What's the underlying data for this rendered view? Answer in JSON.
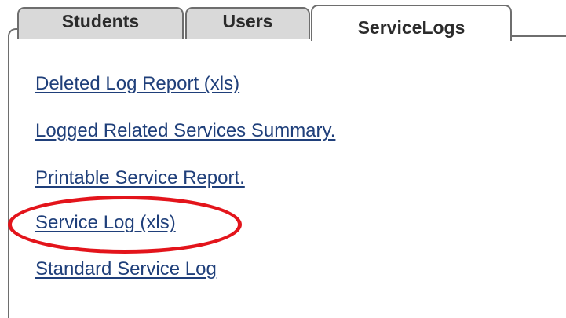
{
  "tabs": [
    {
      "label": "Students",
      "active": false
    },
    {
      "label": "Users",
      "active": false
    },
    {
      "label": "ServiceLogs",
      "active": true
    }
  ],
  "reports": [
    {
      "label": "Deleted Log Report (xls)"
    },
    {
      "label": "Logged Related Services Summary."
    },
    {
      "label": "Printable Service Report."
    },
    {
      "label": "Service Log (xls)",
      "highlighted": true
    },
    {
      "label": "Standard Service Log"
    }
  ],
  "colors": {
    "link": "#1f3f7a",
    "tab_inactive": "#d9d9d9",
    "tab_border": "#6e6e6e",
    "highlight": "#e3141b"
  }
}
